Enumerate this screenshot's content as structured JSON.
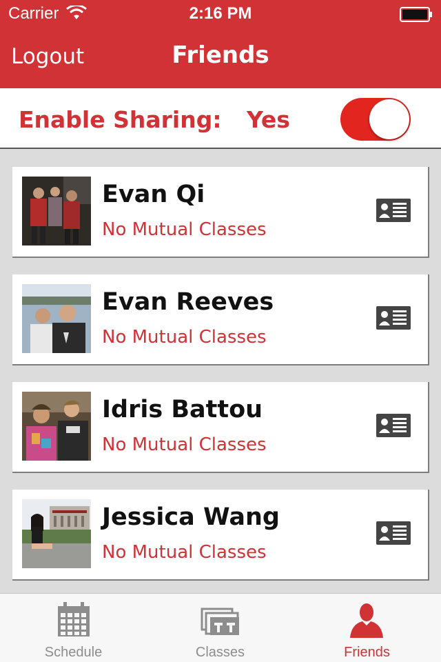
{
  "status_bar": {
    "carrier": "Carrier",
    "time": "2:16 PM"
  },
  "nav": {
    "left_button": "Logout",
    "title": "Friends"
  },
  "sharing": {
    "label": "Enable Sharing:",
    "value": "Yes",
    "toggle_on": true
  },
  "friends": [
    {
      "name": "Evan Qi",
      "subtitle": "No Mutual Classes",
      "avatar_icon": "photo-three-people-dark-background",
      "action_icon": "contact-card-icon"
    },
    {
      "name": "Evan Reeves",
      "subtitle": "No Mutual Classes",
      "avatar_icon": "photo-two-people-outdoor",
      "action_icon": "contact-card-icon"
    },
    {
      "name": "Idris Battou",
      "subtitle": "No Mutual Classes",
      "avatar_icon": "photo-two-people-tie-dye",
      "action_icon": "contact-card-icon"
    },
    {
      "name": "Jessica Wang",
      "subtitle": "No Mutual Classes",
      "avatar_icon": "photo-person-seated-campus",
      "action_icon": "contact-card-icon"
    }
  ],
  "tabs": [
    {
      "label": "Schedule",
      "icon": "calendar-icon",
      "active": false
    },
    {
      "label": "Classes",
      "icon": "classes-icon",
      "active": false
    },
    {
      "label": "Friends",
      "icon": "person-icon",
      "active": true
    }
  ],
  "colors": {
    "brand_red": "#d03235",
    "toggle_red": "#e2261f",
    "tab_inactive": "#8d8d8d"
  }
}
